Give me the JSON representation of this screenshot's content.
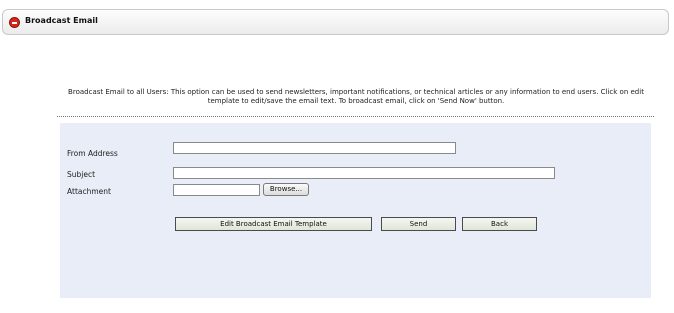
{
  "header": {
    "title": "Broadcast Email",
    "collapse_icon": "minus-circle-icon",
    "icon_color": "#d6261c"
  },
  "description": "Broadcast Email to all Users: This option can be used to send newsletters, important notifications, or technical articles or any information to end users. Click on edit template to edit/save the email text. To broadcast email, click on 'Send Now' button.",
  "form": {
    "from_label": "From Address",
    "from_value": "",
    "subject_label": "Subject",
    "subject_value": "",
    "attachment_label": "Attachment",
    "attachment_value": "",
    "browse_label": "Browse..."
  },
  "buttons": {
    "edit_template": "Edit Broadcast Email Template",
    "send": "Send",
    "back": "Back"
  },
  "colors": {
    "panel_background": "#e8edf8"
  }
}
